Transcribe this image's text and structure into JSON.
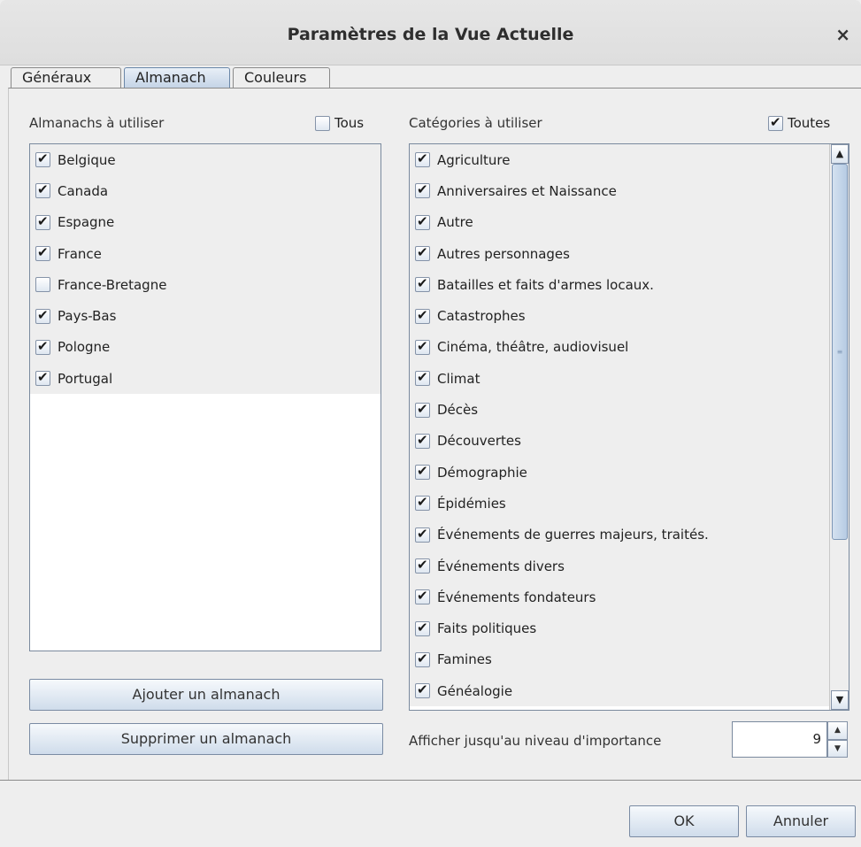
{
  "window": {
    "title": "Paramètres de la Vue Actuelle",
    "close_glyph": "×"
  },
  "tabs": [
    {
      "label": "Généraux",
      "active": false
    },
    {
      "label": "Almanach",
      "active": true
    },
    {
      "label": "Couleurs",
      "active": false
    }
  ],
  "almanacs": {
    "label": "Almanachs à utiliser",
    "all_label": "Tous",
    "all_checked": false,
    "items": [
      {
        "label": "Belgique",
        "checked": true
      },
      {
        "label": "Canada",
        "checked": true
      },
      {
        "label": "Espagne",
        "checked": true
      },
      {
        "label": "France",
        "checked": true
      },
      {
        "label": "France-Bretagne",
        "checked": false
      },
      {
        "label": "Pays-Bas",
        "checked": true
      },
      {
        "label": "Pologne",
        "checked": true
      },
      {
        "label": "Portugal",
        "checked": true
      }
    ],
    "add_button": "Ajouter un almanach",
    "remove_button": "Supprimer un almanach"
  },
  "categories": {
    "label": "Catégories à utiliser",
    "all_label": "Toutes",
    "all_checked": true,
    "items": [
      {
        "label": "Agriculture",
        "checked": true
      },
      {
        "label": "Anniversaires et Naissance",
        "checked": true
      },
      {
        "label": "Autre",
        "checked": true
      },
      {
        "label": "Autres personnages",
        "checked": true
      },
      {
        "label": "Batailles et faits d'armes locaux.",
        "checked": true
      },
      {
        "label": "Catastrophes",
        "checked": true
      },
      {
        "label": "Cinéma, théâtre, audiovisuel",
        "checked": true
      },
      {
        "label": "Climat",
        "checked": true
      },
      {
        "label": "Décès",
        "checked": true
      },
      {
        "label": "Découvertes",
        "checked": true
      },
      {
        "label": "Démographie",
        "checked": true
      },
      {
        "label": "Épidémies",
        "checked": true
      },
      {
        "label": "Événements de guerres majeurs, traités.",
        "checked": true
      },
      {
        "label": "Événements divers",
        "checked": true
      },
      {
        "label": "Événements fondateurs",
        "checked": true
      },
      {
        "label": "Faits politiques",
        "checked": true
      },
      {
        "label": "Famines",
        "checked": true
      },
      {
        "label": "Généalogie",
        "checked": true
      }
    ]
  },
  "importance": {
    "label": "Afficher jusqu'au niveau d'importance",
    "value": "9"
  },
  "buttons": {
    "ok": "OK",
    "cancel": "Annuler"
  }
}
